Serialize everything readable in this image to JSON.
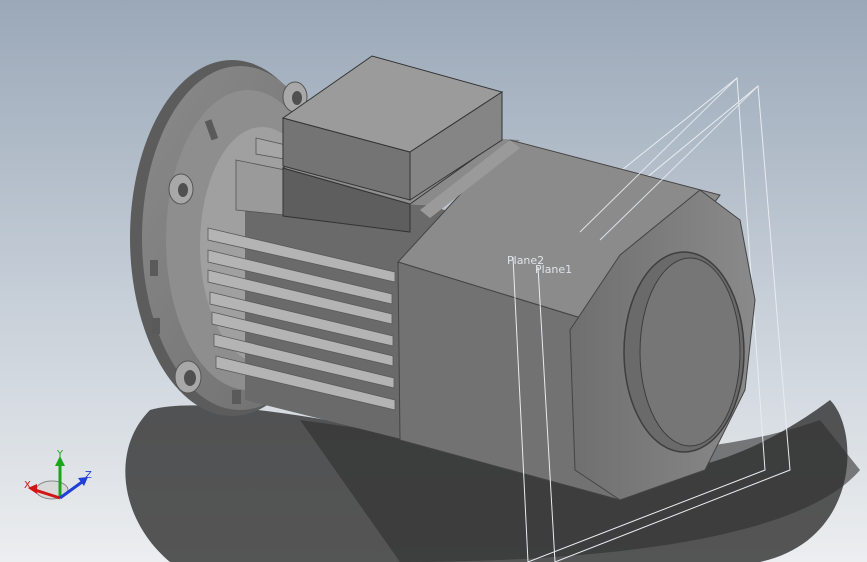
{
  "viewport": {
    "background_top": "#9aa8b8",
    "background_bottom": "#e9ecef",
    "model_color": "#7e7e7e"
  },
  "planes": [
    {
      "name": "Plane2"
    },
    {
      "name": "Plane1"
    }
  ],
  "triad": {
    "x_label": "X",
    "y_label": "Y",
    "z_label": "Z",
    "x_color": "#d21414",
    "y_color": "#1aa51a",
    "z_color": "#1f3fd6"
  }
}
